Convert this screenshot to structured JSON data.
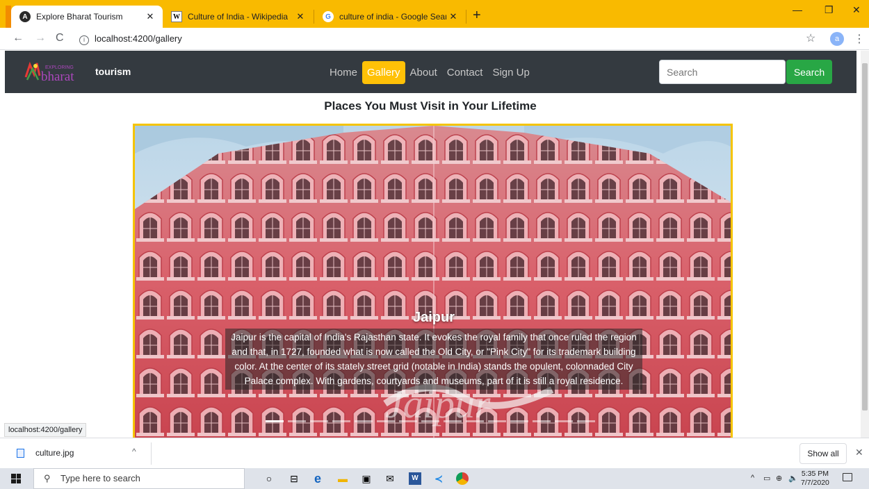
{
  "browser": {
    "tabs": [
      {
        "title": "Explore Bharat Tourism",
        "favicon": "angular-icon",
        "active": true
      },
      {
        "title": "Culture of India - Wikipedia",
        "favicon": "wikipedia-icon",
        "active": false
      },
      {
        "title": "culture of india - Google Search",
        "favicon": "google-icon",
        "active": false
      }
    ],
    "address": "localhost:4200/gallery",
    "profile_initial": "a"
  },
  "site": {
    "logo_text": "bharat",
    "logo_small": "EXPLORING",
    "brand": "tourism",
    "nav": [
      {
        "label": "Home",
        "active": false
      },
      {
        "label": "Gallery",
        "active": true
      },
      {
        "label": "About",
        "active": false
      },
      {
        "label": "Contact",
        "active": false
      },
      {
        "label": "Sign Up",
        "active": false
      }
    ],
    "search_placeholder": "Search",
    "search_button": "Search",
    "heading": "Places You Must Visit in Your Lifetime",
    "slide": {
      "title": "Jaipur",
      "text": "Jaipur is the capital of India's Rajasthan state. It evokes the royal family that once ruled the region and that, in 1727, founded what is now called the Old City, or \"Pink City\" for its trademark building color. At the center of its stately street grid (notable in India) stands the opulent, colonnaded City Palace complex. With gardens, courtyards and museums, part of it is still a royal residence.",
      "watermark": "Jaipur",
      "active_indicator": 0,
      "indicator_count": 15
    }
  },
  "status_url": "localhost:4200/gallery",
  "downloads": {
    "file": "culture.jpg",
    "show_all": "Show all"
  },
  "taskbar": {
    "search_placeholder": "Type here to search",
    "time": "5:35 PM",
    "date": "7/7/2020"
  },
  "colors": {
    "tabstrip": "#f9ba00",
    "navbar": "#343a40",
    "active_nav": "#ffc107",
    "search_button": "#28a745",
    "carousel_border": "#f5c400",
    "palace_pink": "#d9606a"
  }
}
